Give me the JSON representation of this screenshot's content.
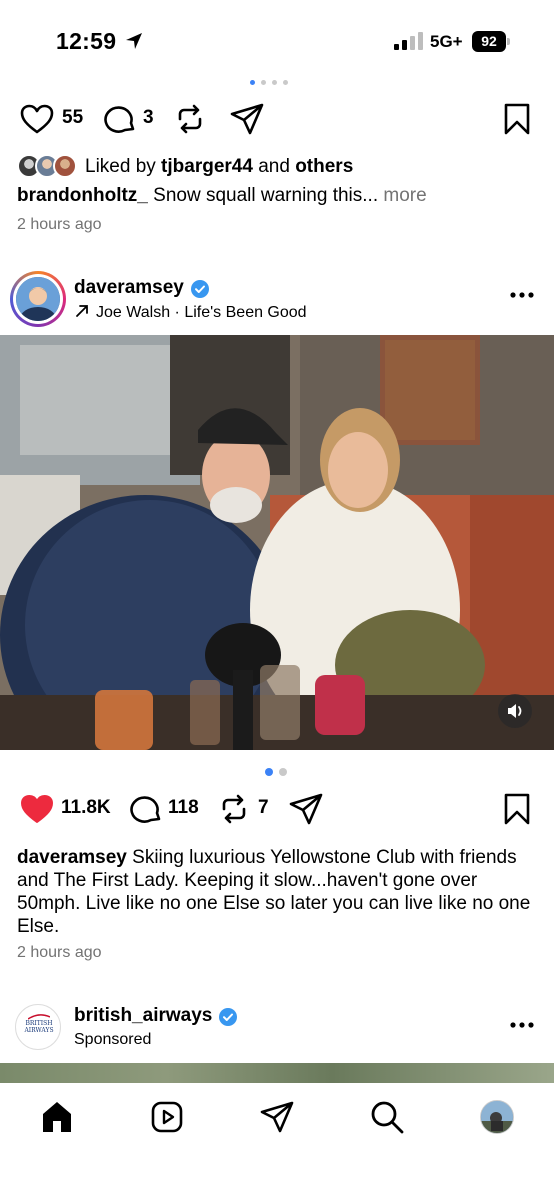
{
  "status_bar": {
    "time": "12:59",
    "network": "5G+",
    "battery": "92"
  },
  "prev_post": {
    "likes": "55",
    "comments": "3",
    "liked_by_prefix": "Liked by ",
    "liked_by_user": "tjbarger44",
    "liked_by_and": " and ",
    "liked_by_others": "others",
    "caption_user": "brandonholtz_",
    "caption_text": " Snow squall warning this...",
    "more": " more",
    "time": "2 hours ago"
  },
  "post": {
    "username": "daveramsey",
    "music": "Joe Walsh · Life's Been Good",
    "likes": "11.8K",
    "comments": "118",
    "reposts": "7",
    "caption_user": "daveramsey",
    "caption_text": " Skiing luxurious Yellowstone Club with friends and The First Lady. Keeping it slow...haven't gone over 50mph. Live like no one Else so later you can live like no one Else.",
    "time": "2 hours ago",
    "carousel_total": 2,
    "carousel_active": 1,
    "liked": true
  },
  "sponsored_post": {
    "username": "british_airways",
    "label": "Sponsored",
    "logo_text": "BRITISH AIRWAYS"
  },
  "colors": {
    "like_red": "#ed2a3e",
    "verified_blue": "#3897f0",
    "dot_active": "#3b82f6",
    "muted_text": "#737373"
  },
  "icons": [
    "location-arrow-icon",
    "signal-icon",
    "battery-icon",
    "heart-icon",
    "comment-icon",
    "repost-icon",
    "share-icon",
    "bookmark-icon",
    "verified-icon",
    "music-arrow-icon",
    "more-options-icon",
    "volume-icon",
    "home-icon",
    "reels-icon",
    "direct-message-icon",
    "search-icon",
    "profile-icon"
  ]
}
